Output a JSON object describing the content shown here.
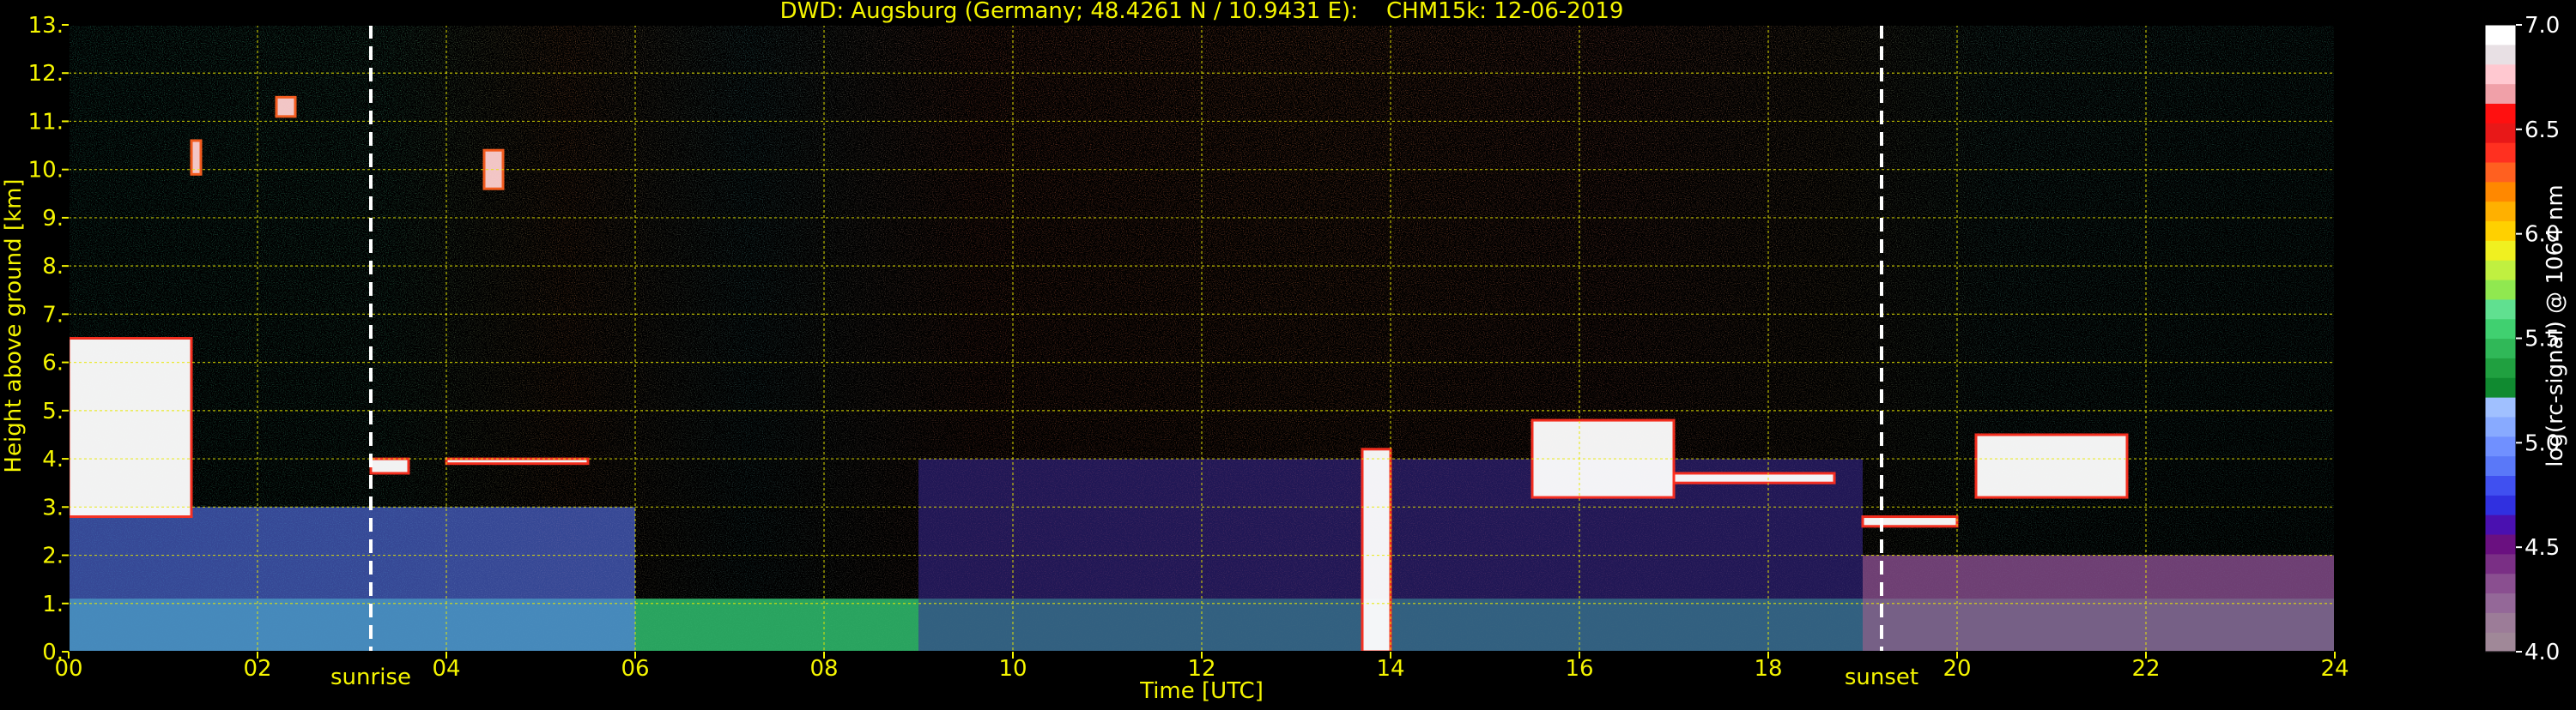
{
  "chart_data": {
    "type": "heatmap",
    "title": "DWD: Augsburg (Germany; 48.4261 N / 10.9431 E):    CHM15k: 12-06-2019",
    "xlabel": "Time [UTC]",
    "ylabel": "Height above ground [km]",
    "xlim": [
      0,
      24
    ],
    "ylim": [
      0,
      13
    ],
    "x_ticks": [
      "00",
      "02",
      "04",
      "06",
      "08",
      "10",
      "12",
      "14",
      "16",
      "18",
      "20",
      "22",
      "24"
    ],
    "y_ticks": [
      "0.",
      "1.",
      "2.",
      "3.",
      "4.",
      "5.",
      "6.",
      "7.",
      "8.",
      "9.",
      "10.",
      "11.",
      "12.",
      "13."
    ],
    "grid": true,
    "annotations": [
      {
        "label": "sunrise",
        "time": 3.2
      },
      {
        "label": "sunset",
        "time": 19.2
      }
    ],
    "colorbar": {
      "label": "log(rc-signal) @ 1064 nm",
      "min": 4.0,
      "max": 7.0,
      "ticks": [
        "4.0",
        "4.5",
        "5.0",
        "5.5",
        "6.0",
        "6.5",
        "7.0"
      ],
      "colors": [
        "#a08898",
        "#9c7c98",
        "#946898",
        "#8a4f90",
        "#7a2f85",
        "#6a1080",
        "#4a10b0",
        "#3030e0",
        "#4050f0",
        "#5a78f8",
        "#7090ff",
        "#88aaff",
        "#a0c0ff",
        "#108a30",
        "#20a040",
        "#30b858",
        "#40d070",
        "#60e090",
        "#90e850",
        "#c0f040",
        "#f0f020",
        "#ffd000",
        "#ffb000",
        "#ff8800",
        "#ff6020",
        "#ff3020",
        "#e81818",
        "#ff1010",
        "#f0a0a8",
        "#ffc8d0",
        "#e8e0e4",
        "#ffffff"
      ]
    },
    "layers": [
      {
        "type": "surface_aerosol",
        "time_range": [
          0,
          24
        ],
        "height_km": [
          0,
          1.1
        ]
      },
      {
        "type": "nocturnal_residual_layer",
        "time_range": [
          0,
          6
        ],
        "height_km": [
          0,
          3.0
        ]
      },
      {
        "type": "convective_boundary_layer",
        "time_range": [
          9,
          19
        ],
        "height_km": [
          0,
          4.0
        ]
      },
      {
        "type": "cloud",
        "time_range": [
          0,
          1.3
        ],
        "height_km": [
          2.8,
          6.5
        ]
      },
      {
        "type": "cloud",
        "time_range": [
          3.2,
          3.6
        ],
        "height_km": [
          3.7,
          4.0
        ]
      },
      {
        "type": "cloud",
        "time_range": [
          4.0,
          5.5
        ],
        "height_km": [
          3.9,
          4.0
        ]
      },
      {
        "type": "cirrus",
        "time_range": [
          1.3,
          1.4
        ],
        "height_km": [
          9.9,
          10.6
        ]
      },
      {
        "type": "cirrus",
        "time_range": [
          4.4,
          4.6
        ],
        "height_km": [
          9.6,
          10.4
        ]
      },
      {
        "type": "cirrus",
        "time_range": [
          2.2,
          2.4
        ],
        "height_km": [
          11.1,
          11.5
        ]
      },
      {
        "type": "cloud",
        "time_range": [
          13.7,
          14.0
        ],
        "height_km": [
          0,
          4.2
        ]
      },
      {
        "type": "cloud",
        "time_range": [
          15.5,
          17.0
        ],
        "height_km": [
          3.2,
          4.8
        ]
      },
      {
        "type": "cloud",
        "time_range": [
          17.0,
          18.7
        ],
        "height_km": [
          3.5,
          3.7
        ]
      },
      {
        "type": "cloud",
        "time_range": [
          19.0,
          20.0
        ],
        "height_km": [
          2.6,
          2.8
        ]
      },
      {
        "type": "cloud",
        "time_range": [
          20.2,
          21.8
        ],
        "height_km": [
          3.2,
          4.5
        ]
      },
      {
        "type": "residual_layer_evening",
        "time_range": [
          19,
          24
        ],
        "height_km": [
          0,
          2.0
        ]
      }
    ]
  }
}
